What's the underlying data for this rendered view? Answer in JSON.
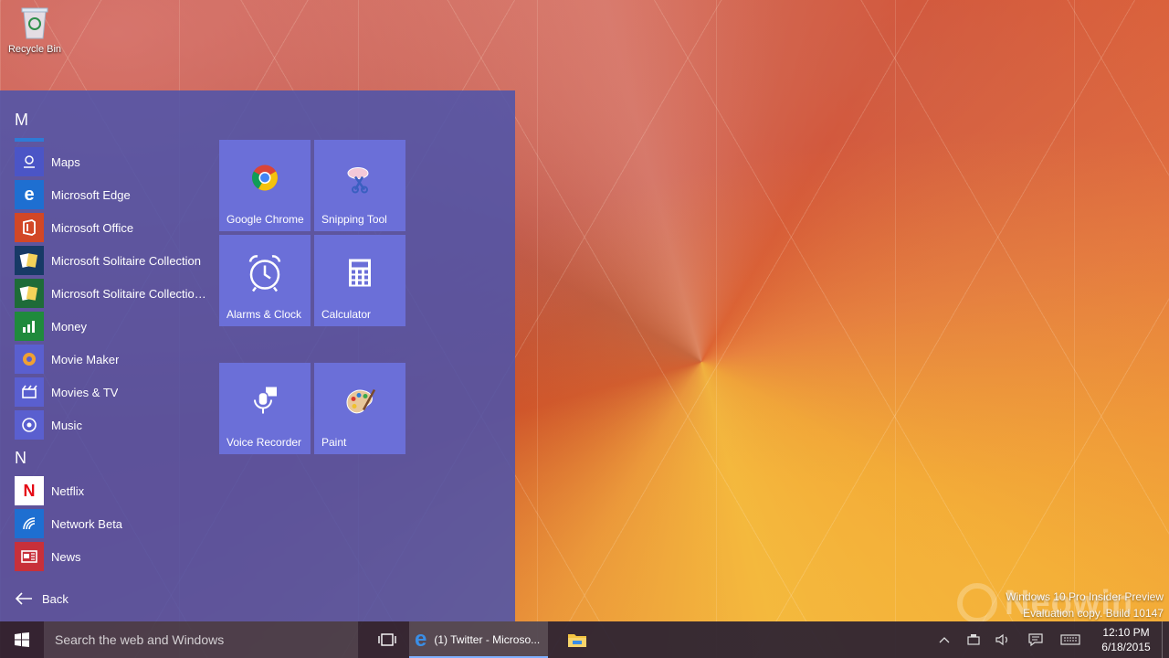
{
  "desktop": {
    "recycle_bin_label": "Recycle Bin"
  },
  "start_menu": {
    "groups": [
      {
        "letter": "M"
      },
      {
        "letter": "N"
      }
    ],
    "apps": [
      {
        "label": "Maps",
        "icon": "maps-icon",
        "color": "#4b55c6"
      },
      {
        "label": "Microsoft Edge",
        "icon": "edge-icon",
        "color": "#1e6fd1"
      },
      {
        "label": "Microsoft Office",
        "icon": "office-icon",
        "color": "#d24726"
      },
      {
        "label": "Microsoft Solitaire Collection",
        "icon": "solitaire-icon",
        "color": "#173a66"
      },
      {
        "label": "Microsoft Solitaire Collection...",
        "icon": "solitaire-icon",
        "color": "#1e6b38"
      },
      {
        "label": "Money",
        "icon": "money-icon",
        "color": "#1f8a3c"
      },
      {
        "label": "Movie Maker",
        "icon": "movie-maker-icon",
        "color": "#5a5fcf"
      },
      {
        "label": "Movies & TV",
        "icon": "movies-tv-icon",
        "color": "#5a5fcf"
      },
      {
        "label": "Music",
        "icon": "music-icon",
        "color": "#5a5fcf"
      },
      {
        "label": "Netflix",
        "icon": "netflix-icon",
        "color": "#ffffff"
      },
      {
        "label": "Network Beta",
        "icon": "network-icon",
        "color": "#1e6fd1"
      },
      {
        "label": "News",
        "icon": "news-icon",
        "color": "#c8303a"
      }
    ],
    "back_label": "Back",
    "tiles": [
      {
        "label": "Google Chrome",
        "icon": "chrome-icon"
      },
      {
        "label": "Snipping Tool",
        "icon": "snipping-tool-icon"
      },
      {
        "label": "Alarms & Clock",
        "icon": "alarm-clock-icon"
      },
      {
        "label": "Calculator",
        "icon": "calculator-icon"
      },
      {
        "label": "Voice Recorder",
        "icon": "microphone-icon"
      },
      {
        "label": "Paint",
        "icon": "paint-palette-icon"
      }
    ]
  },
  "watermark": {
    "line1": "Windows 10 Pro Insider Preview",
    "line2": "Evaluation copy. Build 10147",
    "brand": "Neowin"
  },
  "taskbar": {
    "search_placeholder": "Search the web and Windows",
    "active_task_label": "(1) Twitter - Microso...",
    "time": "12:10 PM",
    "date": "6/18/2015"
  },
  "colors": {
    "start_bg": "#4e54aa",
    "tile_bg": "#6b6fd8",
    "taskbar_bg": "#282032",
    "accent": "#2e7bd6"
  }
}
